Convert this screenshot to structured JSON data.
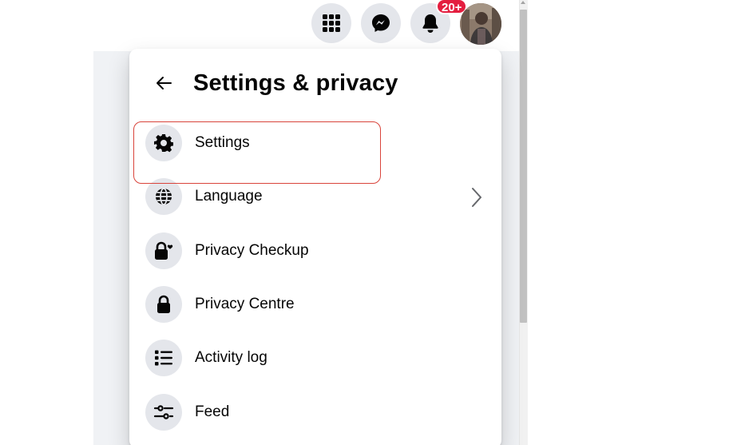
{
  "topbar": {
    "menu_icon": "grid-menu-icon",
    "messenger_icon": "messenger-icon",
    "notifications_icon": "bell-icon",
    "notification_badge": "20+",
    "badge_color": "#e41e3f",
    "avatar": "profile-avatar"
  },
  "panel": {
    "title": "Settings & privacy",
    "back_icon": "back-arrow-icon",
    "items": [
      {
        "label": "Settings",
        "icon": "gear-icon",
        "highlighted": true
      },
      {
        "label": "Language",
        "icon": "globe-icon",
        "has_submenu": true
      },
      {
        "label": "Privacy Checkup",
        "icon": "lock-heart-icon"
      },
      {
        "label": "Privacy Centre",
        "icon": "lock-icon"
      },
      {
        "label": "Activity log",
        "icon": "list-icon"
      },
      {
        "label": "Feed",
        "icon": "sliders-icon"
      }
    ]
  },
  "colors": {
    "icon_bg": "#e4e6eb",
    "text": "#050505",
    "highlight_border": "#d9443b"
  }
}
